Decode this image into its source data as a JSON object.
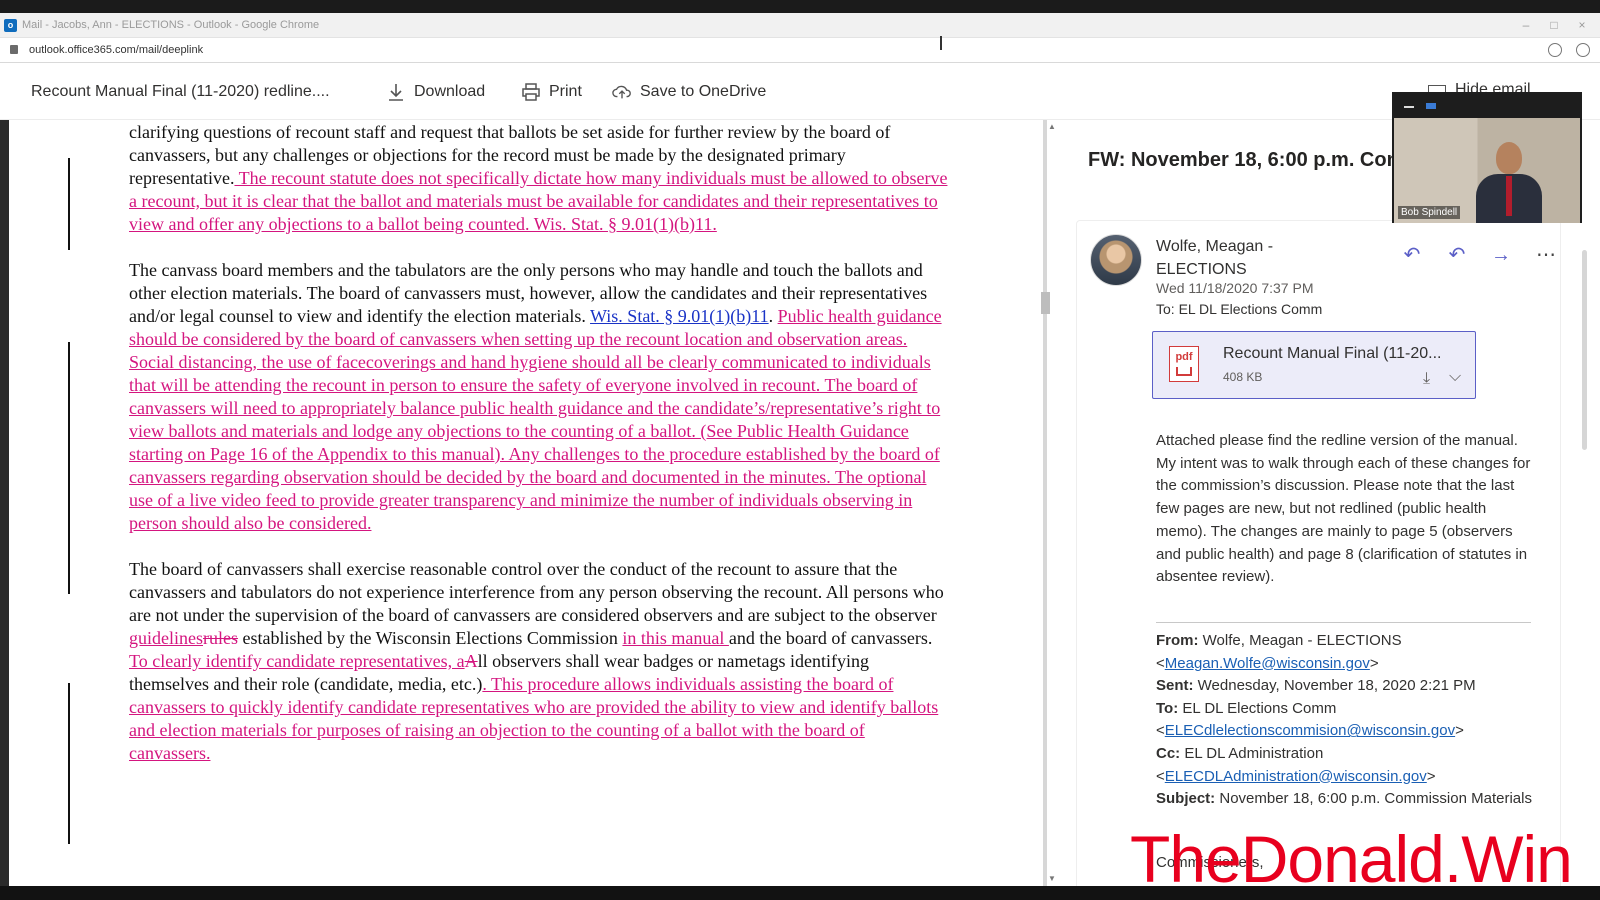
{
  "browser": {
    "window_title": "Mail - Jacobs, Ann - ELECTIONS - Outlook - Google Chrome",
    "url": "outlook.office365.com/mail/deeplink"
  },
  "viewer_toolbar": {
    "doc_title": "Recount Manual Final (11-2020) redline....",
    "download_label": "Download",
    "print_label": "Print",
    "save_label": "Save to OneDrive",
    "hide_email_label": "Hide email"
  },
  "document": {
    "p1": {
      "a": "clarifying questions of recount staff and request that ballots be set aside for further review by the board of canvassers, but any challenges or objections for the record must be made by the designated primary representative.",
      "ins": " The recount statute does not specifically dictate how many individuals must be allowed to observe a recount, but it is clear that the ballot and materials must be available for candidates and their representatives to view and offer any objections to a ballot being counted.  Wis. Stat. § 9.01(1)(b)11."
    },
    "p2": {
      "a": "The canvass board members and the tabulators are the only persons who may handle and touch the ballots and other election materials.  The board of canvassers must, however, allow the candidates and their representatives and/or legal counsel to view and identify the election materials.  ",
      "link": "Wis. Stat. § 9.01(1)(b)11",
      "b": ".  ",
      "ins": "Public health guidance should be considered by the board of canvassers when setting up the recount location and observation areas.  Social distancing, the use of facecoverings and hand hygiene should all be clearly communicated to individuals that will be attending the recount in person to ensure the safety of everyone involved in recount.  The board of canvassers will need to appropriately balance public health guidance and the candidate’s/representative’s right to view ballots and materials and lodge any objections to the counting of a ballot. (See Public Health Guidance starting on Page 16 of the Appendix to this manual).  Any challenges to the procedure established by the board of canvassers regarding observation should be decided by the board and documented in the minutes.  The optional use of a live video feed to provide greater transparency and minimize the number of individuals observing in person should also be considered."
    },
    "p3": {
      "a": "The board of canvassers shall exercise reasonable control over the conduct of the recount to assure that the canvassers and tabulators do not experience interference from any person observing the recount.  All persons who are not under the supervision of the board of canvassers are considered observers and are subject to the observer ",
      "ins1": "guidelines",
      "del1": "rules",
      "b": " established by the Wisconsin Elections Commission ",
      "ins2": "in this manual ",
      "c": "and the board of canvassers.  ",
      "ins3": "To clearly identify candidate representatives, a",
      "del2": "A",
      "d": "ll observers shall wear badges or nametags identifying themselves and their role (candidate, media, etc.)",
      "ins4": ".  This procedure allows individuals assisting the board of canvassers to quickly identify candidate representatives who are provided the ability to view and identify ballots and election materials for purposes of raising an objection to the counting of a ballot with the board of canvassers."
    }
  },
  "email": {
    "subject": "FW: November 18, 6:00 p.m. Commission Materials",
    "sender": "Wolfe, Meagan - ELECTIONS",
    "date": "Wed 11/18/2020 7:37 PM",
    "to": "To:  EL DL Elections Comm",
    "attachment": {
      "name": "Recount Manual Final (11-20...",
      "size": "408 KB"
    },
    "body": "Attached please find the redline version of the manual. My intent was to walk through each of these changes for the commission’s discussion. Please note that the last few pages are new, but not redlined (public health memo).  The changes are mainly to page 5 (observers and public health) and page 8 (clarification of statutes in absentee review).",
    "fwd": {
      "from_label": "From:",
      "from_name": " Wolfe, Meagan - ELECTIONS",
      "from_email": "Meagan.Wolfe@wisconsin.gov",
      "sent_label": "Sent:",
      "sent_value": " Wednesday, November 18, 2020 2:21 PM",
      "to_label": "To:",
      "to_name": " EL DL Elections Comm",
      "to_email": "ELECdlelectionscommision@wisconsin.gov",
      "cc_label": "Cc:",
      "cc_name": " EL DL Administration",
      "cc_email": "ELECDLAdministration@wisconsin.gov",
      "subject_label": "Subject:",
      "subject_value": " November 18, 6:00 p.m. Commission Materials"
    },
    "commissioners": "Commissioners,"
  },
  "video": {
    "participant": "Bob Spindell"
  },
  "watermark": "TheDonald.Win",
  "colors": {
    "insert": "#d4157f",
    "link": "#1a33c6",
    "accent": "#5b5fc7",
    "watermark": "#e8001e"
  }
}
